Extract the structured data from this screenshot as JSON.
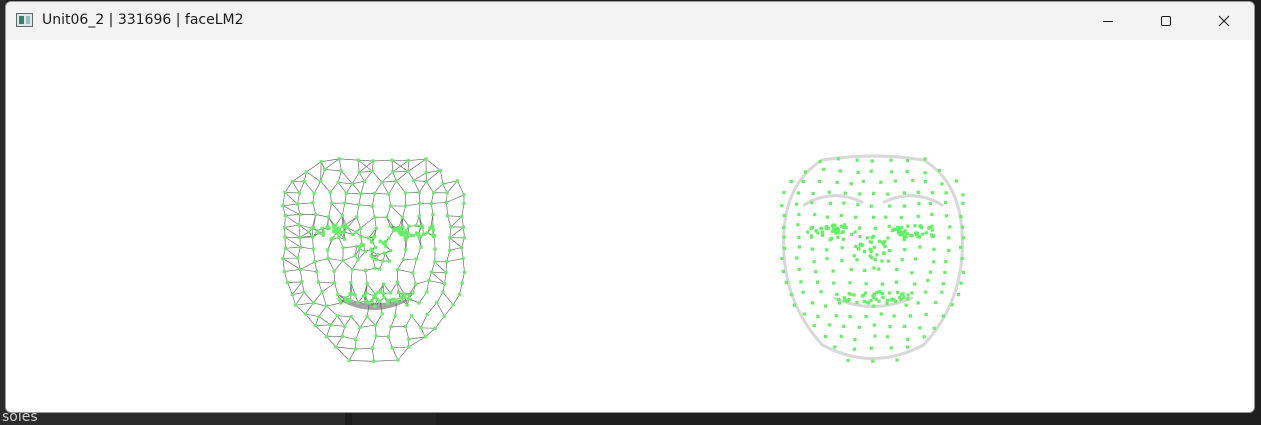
{
  "window": {
    "title": "Unit06_2 | 331696 | faceLM2",
    "icon": "app-window-icon",
    "controls": {
      "minimize": "minimize-icon",
      "maximize": "maximize-icon",
      "close": "close-icon"
    }
  },
  "background": {
    "bottom_text": "soles"
  },
  "colors": {
    "titlebar": "#f3f3f3",
    "canvas": "#ffffff",
    "landmark": "#66ee66",
    "mesh": "#6e6e6e",
    "contour": "#d8d8d8"
  }
}
